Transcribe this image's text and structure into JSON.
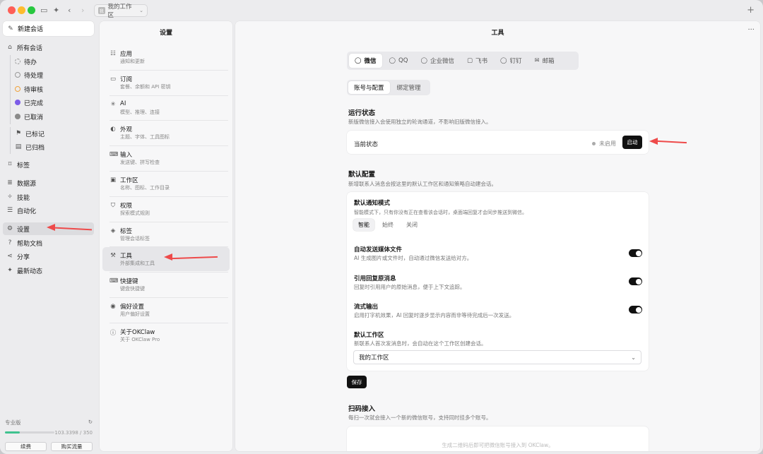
{
  "window": {
    "workspace_label": "我的工作区"
  },
  "sidebar": {
    "new_chat": "新建会话",
    "all_chats": "所有会话",
    "statuses": [
      "待办",
      "待处理",
      "待审核",
      "已完成",
      "已取消"
    ],
    "flagged": "已标记",
    "archived": "已归档",
    "tags": "标签",
    "datasource": "数据源",
    "skills": "技能",
    "automation": "自动化",
    "settings": "设置",
    "help": "帮助文档",
    "share": "分享",
    "updates": "最新动态",
    "plan": {
      "label": "专业版",
      "usage": "103.3398 / 350",
      "progress": 0.295,
      "renew": "续费",
      "buy": "购买流量"
    }
  },
  "settings": {
    "title": "设置",
    "items": [
      {
        "title": "应用",
        "sub": "通知和更新",
        "icon": "sliders-icon"
      },
      {
        "title": "订阅",
        "sub": "套餐、余额和 API 密钥",
        "icon": "card-icon"
      },
      {
        "title": "AI",
        "sub": "模型、推理、连接",
        "icon": "sparkle-icon"
      },
      {
        "title": "外观",
        "sub": "主题、字体、工具图标",
        "icon": "palette-icon"
      },
      {
        "title": "输入",
        "sub": "发送键、拼写检查",
        "icon": "keyboard-icon"
      },
      {
        "title": "工作区",
        "sub": "名称、图标、工作目录",
        "icon": "folder-icon"
      },
      {
        "title": "权限",
        "sub": "探索模式规则",
        "icon": "shield-icon"
      },
      {
        "title": "标签",
        "sub": "管理会话标签",
        "icon": "tag-icon"
      },
      {
        "title": "工具",
        "sub": "外部集成和工具",
        "icon": "wrench-icon"
      },
      {
        "title": "快捷键",
        "sub": "键盘快捷键",
        "icon": "keyboard-icon"
      },
      {
        "title": "偏好设置",
        "sub": "用户偏好设置",
        "icon": "user-icon"
      },
      {
        "title": "关于OKClaw",
        "sub": "关于 OKClaw Pro",
        "icon": "info-icon"
      }
    ]
  },
  "main": {
    "title": "工具",
    "channels": [
      "微信",
      "QQ",
      "企业微信",
      "飞书",
      "钉钉",
      "邮箱"
    ],
    "subtabs": [
      "账号与配置",
      "绑定管理"
    ],
    "run_status": {
      "title": "运行状态",
      "desc": "新版微信接入会使用独立的轮询通道，不影响旧版微信接入。",
      "label": "当前状态",
      "value": "未启用",
      "start": "启动"
    },
    "defaults": {
      "title": "默认配置",
      "desc": "新增联系人消息会按这里的默认工作区和通知策略自动建会话。",
      "notify_title": "默认通知模式",
      "notify_desc": "智能模式下，只有你没有正在查看该会话时，桌面端回复才会同步推送到微信。",
      "modes": [
        "智能",
        "始终",
        "关闭"
      ],
      "auto_media_title": "自动发送媒体文件",
      "auto_media_desc": "AI 生成图片或文件时，自动通过微信发送给对方。",
      "quote_title": "引用回复原消息",
      "quote_desc": "回复时引用用户的原始消息，便于上下文追踪。",
      "stream_title": "流式输出",
      "stream_desc": "启用打字机效果，AI 回复时逐步显示内容而非等待完成后一次发送。",
      "ws_title": "默认工作区",
      "ws_desc": "新联系人首次发消息时，会自动在这个工作区创建会话。",
      "ws_value": "我的工作区",
      "save": "保存"
    },
    "qr": {
      "title": "扫码接入",
      "desc": "每扫一次就会接入一个新的微信账号，支持同时挂多个账号。",
      "hint": "生成二维码后即可把微信账号接入到 OKClaw。"
    }
  }
}
